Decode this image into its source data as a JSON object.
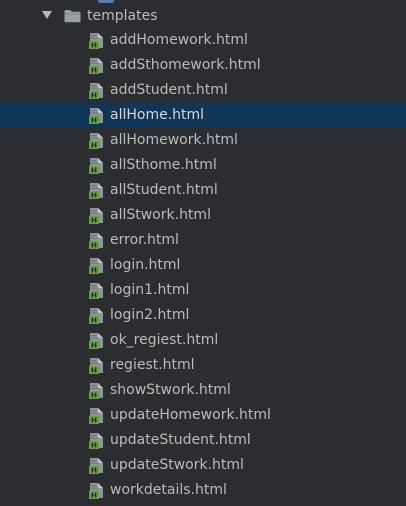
{
  "folder": {
    "name": "templates",
    "expanded": true
  },
  "files": [
    {
      "name": "addHomework.html",
      "icon": "html-file-icon",
      "selected": false
    },
    {
      "name": "addSthomework.html",
      "icon": "html-file-icon",
      "selected": false
    },
    {
      "name": "addStudent.html",
      "icon": "html-file-icon",
      "selected": false
    },
    {
      "name": "allHome.html",
      "icon": "html-file-icon",
      "selected": true
    },
    {
      "name": "allHomework.html",
      "icon": "html-file-icon",
      "selected": false
    },
    {
      "name": "allSthome.html",
      "icon": "html-file-icon",
      "selected": false
    },
    {
      "name": "allStudent.html",
      "icon": "html-file-icon",
      "selected": false
    },
    {
      "name": "allStwork.html",
      "icon": "html-file-icon",
      "selected": false
    },
    {
      "name": "error.html",
      "icon": "html-file-icon",
      "selected": false
    },
    {
      "name": "login.html",
      "icon": "html-file-icon",
      "selected": false
    },
    {
      "name": "login1.html",
      "icon": "html-file-icon",
      "selected": false
    },
    {
      "name": "login2.html",
      "icon": "html-file-icon",
      "selected": false
    },
    {
      "name": "ok_regiest.html",
      "icon": "html-file-icon",
      "selected": false
    },
    {
      "name": "regiest.html",
      "icon": "html-file-icon",
      "selected": false
    },
    {
      "name": "showStwork.html",
      "icon": "html-file-icon",
      "selected": false
    },
    {
      "name": "updateHomework.html",
      "icon": "html-file-icon",
      "selected": false
    },
    {
      "name": "updateStudent.html",
      "icon": "html-file-icon",
      "selected": false
    },
    {
      "name": "updateStwork.html",
      "icon": "html-file-icon",
      "selected": false
    },
    {
      "name": "workdetails.html",
      "icon": "html-file-icon",
      "selected": false
    }
  ],
  "colors": {
    "background": "#2b2d30",
    "selection": "#0f3656",
    "text": "#bbbbbb",
    "html_icon_green": "#62a340",
    "folder_gray": "#9aa0a6"
  }
}
